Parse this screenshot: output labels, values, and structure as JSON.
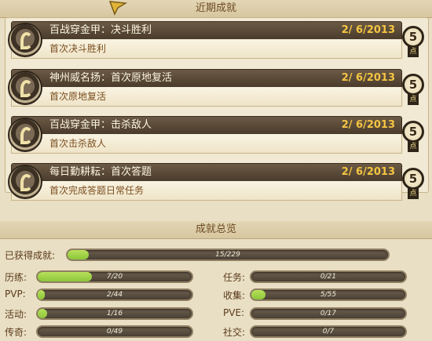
{
  "recent": {
    "header": "近期成就",
    "items": [
      {
        "title": "百战穿金甲：决斗胜利",
        "date": "2/ 6/2013",
        "desc": "首次决斗胜利",
        "points": "5"
      },
      {
        "title": "神州威名扬：首次原地复活",
        "date": "2/ 6/2013",
        "desc": "首次原地复活",
        "points": "5"
      },
      {
        "title": "百战穿金甲：击杀敌人",
        "date": "2/ 6/2013",
        "desc": "首次击杀敌人",
        "points": "5"
      },
      {
        "title": "每日勤耕耘：首次答题",
        "date": "2/ 6/2013",
        "desc": "首次完成答题日常任务",
        "points": "5"
      }
    ]
  },
  "summary": {
    "header": "成就总览",
    "total": {
      "label": "已获得成就:",
      "text": "15/229",
      "value": 15,
      "max": 229
    },
    "left": [
      {
        "label": "历练:",
        "text": "7/20",
        "value": 7,
        "max": 20
      },
      {
        "label": "PVP:",
        "text": "2/44",
        "value": 2,
        "max": 44
      },
      {
        "label": "活动:",
        "text": "1/16",
        "value": 1,
        "max": 16
      },
      {
        "label": "传奇:",
        "text": "0/49",
        "value": 0,
        "max": 49
      }
    ],
    "right": [
      {
        "label": "任务:",
        "text": "0/21",
        "value": 0,
        "max": 21
      },
      {
        "label": "收集:",
        "text": "5/55",
        "value": 5,
        "max": 55
      },
      {
        "label": "PVE:",
        "text": "0/17",
        "value": 0,
        "max": 17
      },
      {
        "label": "社交:",
        "text": "0/7",
        "value": 0,
        "max": 7
      }
    ]
  },
  "colors": {
    "bar_fill": "#8cc63a",
    "date": "#f5c542"
  }
}
